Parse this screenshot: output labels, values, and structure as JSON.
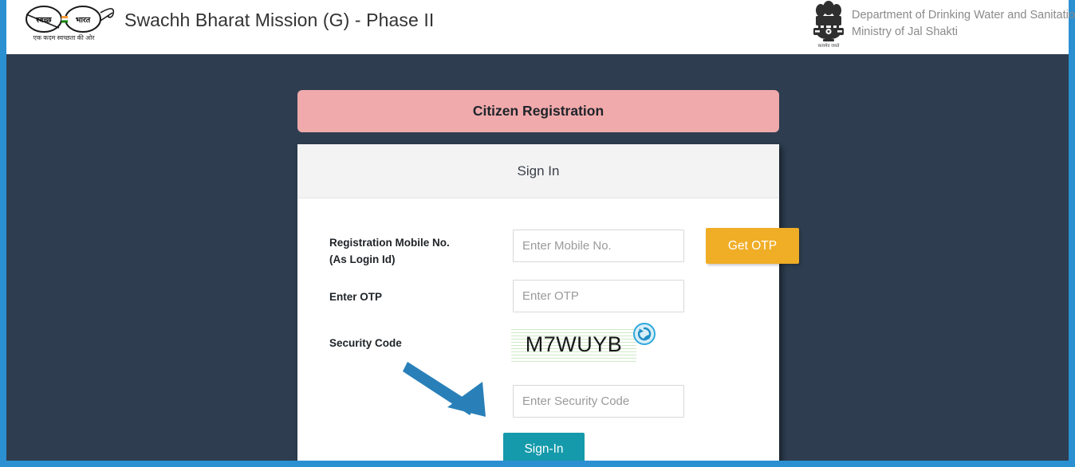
{
  "header": {
    "site_title": "Swachh Bharat Mission (G) - Phase II",
    "logo_alt": "swachh-bharat-mission-logo",
    "logo_word_left": "स्वच्छ",
    "logo_word_right": "भारत",
    "logo_tagline": "एक कदम स्वच्छता की ओर",
    "emblem_alt": "national-emblem-of-india",
    "emblem_motto": "सत्यमेव जयते",
    "department_line1": "Department of Drinking Water and Sanitation",
    "department_line2": "Ministry of Jal Shakti"
  },
  "banner": {
    "title": "Citizen Registration"
  },
  "card": {
    "title": "Sign In"
  },
  "form": {
    "mobile": {
      "label": "Registration Mobile No.",
      "label_sub": "(As Login Id)",
      "placeholder": "Enter Mobile No.",
      "value": ""
    },
    "otp": {
      "label": "Enter OTP",
      "placeholder": "Enter OTP",
      "value": ""
    },
    "security": {
      "label": "Security Code",
      "captcha_text": "M7WUYB",
      "refresh_icon": "refresh-icon",
      "placeholder": "Enter Security Code",
      "value": ""
    },
    "buttons": {
      "get_otp": "Get OTP",
      "sign_in": "Sign-In"
    }
  },
  "colors": {
    "page_background": "#2e3e50",
    "frame": "#2b90d2",
    "banner": "#f0aaab",
    "get_otp": "#f0ad26",
    "sign_in": "#149aab",
    "annotation_arrow": "#2980b9"
  },
  "annotation": {
    "arrow_name": "pointer-arrow-to-signin"
  }
}
